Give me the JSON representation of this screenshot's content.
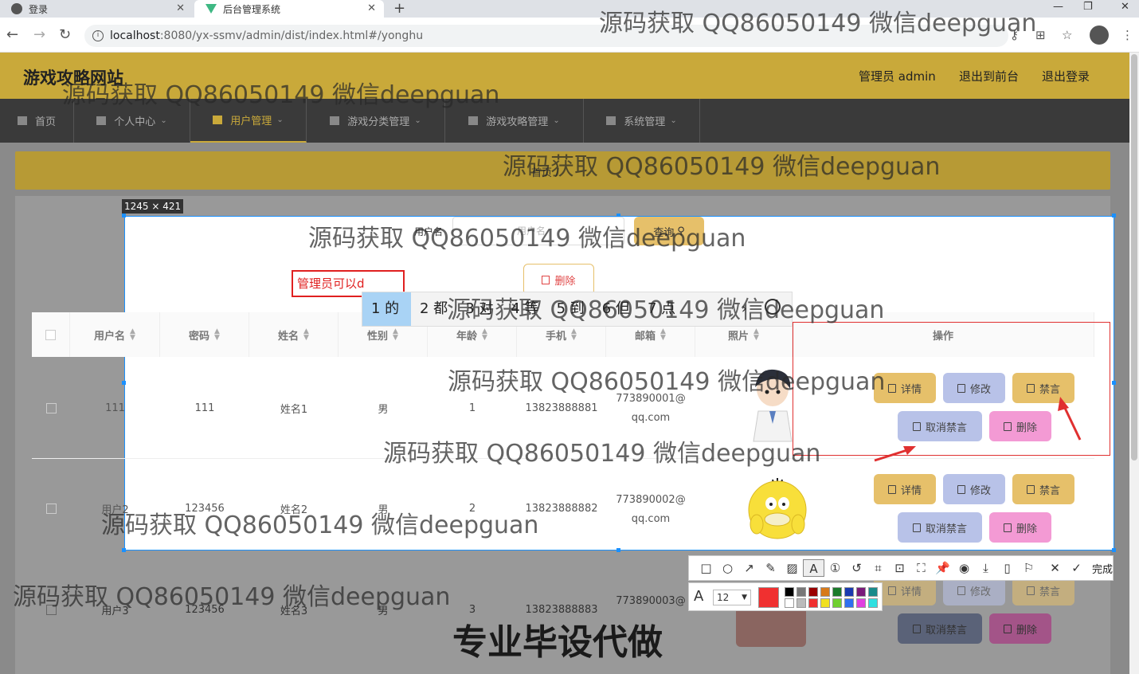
{
  "browser": {
    "tabs": [
      {
        "title": "登录"
      },
      {
        "title": "后台管理系统"
      }
    ],
    "url_host": "localhost",
    "url_path": ":8080/yx-ssmv/admin/dist/index.html#/yonghu"
  },
  "site": {
    "title": "游戏攻略网站",
    "header_links": [
      "管理员 admin",
      "退出到前台",
      "退出登录"
    ],
    "nav": [
      {
        "label": "首页"
      },
      {
        "label": "个人中心"
      },
      {
        "label": "用户管理"
      },
      {
        "label": "游戏分类管理"
      },
      {
        "label": "游戏攻略管理"
      },
      {
        "label": "系统管理"
      }
    ],
    "breadcrumb": "首页 /"
  },
  "search": {
    "label": "用户名",
    "placeholder": "用户名",
    "button": "查询"
  },
  "delete_button": "删除",
  "text_annotation": "管理员可以d",
  "ime": {
    "candidates": [
      "1 的",
      "2 都",
      "3 对",
      "4 等",
      "5 到",
      "6 但",
      "7 点"
    ],
    "next": "›"
  },
  "selection_size": "1245 × 421",
  "table": {
    "headers": [
      "用户名",
      "密码",
      "姓名",
      "性别",
      "年龄",
      "手机",
      "邮箱",
      "照片",
      "操作"
    ],
    "rows": [
      {
        "username": "111",
        "password": "111",
        "name": "姓名1",
        "gender": "男",
        "age": "1",
        "phone": "13823888881",
        "email_1": "773890001@",
        "email_2": "qq.com"
      },
      {
        "username": "用户2",
        "password": "123456",
        "name": "姓名2",
        "gender": "男",
        "age": "2",
        "phone": "13823888882",
        "email_1": "773890002@",
        "email_2": "qq.com"
      },
      {
        "username": "用户3",
        "password": "123456",
        "name": "姓名3",
        "gender": "男",
        "age": "3",
        "phone": "13823888883",
        "email_1": "773890003@",
        "email_2": ""
      }
    ],
    "actions": {
      "detail": "详情",
      "edit": "修改",
      "ban": "禁言",
      "unban": "取消禁言",
      "delete": "删除"
    }
  },
  "snip_toolbar": {
    "done": "完成",
    "font_size": "12"
  },
  "watermark": "源码获取 QQ86050149 微信deepguan",
  "bottom_banner": "专业毕设代做",
  "colors": {
    "brand": "#c9a93a",
    "danger": "#e03030",
    "selection": "#1a90ff"
  }
}
